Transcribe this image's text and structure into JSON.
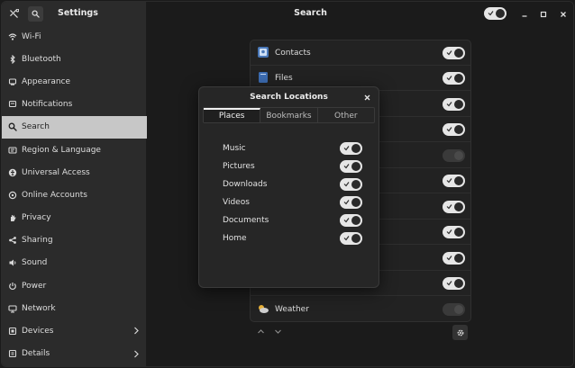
{
  "sidebar": {
    "title": "Settings",
    "items": [
      {
        "label": "Wi-Fi",
        "icon": "wifi-icon"
      },
      {
        "label": "Bluetooth",
        "icon": "bluetooth-icon"
      },
      {
        "label": "Appearance",
        "icon": "appearance-icon"
      },
      {
        "label": "Notifications",
        "icon": "bell-icon"
      },
      {
        "label": "Search",
        "icon": "search-icon",
        "active": true
      },
      {
        "label": "Region & Language",
        "icon": "flag-icon"
      },
      {
        "label": "Universal Access",
        "icon": "accessibility-icon"
      },
      {
        "label": "Online Accounts",
        "icon": "cloud-icon"
      },
      {
        "label": "Privacy",
        "icon": "hand-icon"
      },
      {
        "label": "Sharing",
        "icon": "share-icon"
      },
      {
        "label": "Sound",
        "icon": "speaker-icon"
      },
      {
        "label": "Power",
        "icon": "power-icon"
      },
      {
        "label": "Network",
        "icon": "network-icon"
      },
      {
        "label": "Devices",
        "icon": "devices-icon",
        "chevron": true
      },
      {
        "label": "Details",
        "icon": "info-icon",
        "chevron": true
      }
    ]
  },
  "header": {
    "title": "Search",
    "search_enabled": true
  },
  "search_providers": [
    {
      "label": "Contacts",
      "enabled": true
    },
    {
      "label": "Files",
      "enabled": true
    },
    {
      "label": "",
      "enabled": true
    },
    {
      "label": "",
      "enabled": true
    },
    {
      "label": "",
      "enabled": false
    },
    {
      "label": "",
      "enabled": true
    },
    {
      "label": "",
      "enabled": true
    },
    {
      "label": "",
      "enabled": true
    },
    {
      "label": "",
      "enabled": true
    },
    {
      "label": "",
      "enabled": true
    },
    {
      "label": "Weather",
      "enabled": false
    }
  ],
  "dialog": {
    "title": "Search Locations",
    "tabs": [
      "Places",
      "Bookmarks",
      "Other"
    ],
    "active_tab": "Places",
    "locations": [
      {
        "label": "Music",
        "enabled": true
      },
      {
        "label": "Pictures",
        "enabled": true
      },
      {
        "label": "Downloads",
        "enabled": true
      },
      {
        "label": "Videos",
        "enabled": true
      },
      {
        "label": "Documents",
        "enabled": true
      },
      {
        "label": "Home",
        "enabled": true
      }
    ]
  },
  "colors": {
    "sidebar_bg": "#2b2b2b",
    "active_item_bg": "#c7c7c7",
    "main_bg": "#1b1b1b",
    "switch_on": "#e6e6e6",
    "switch_off": "#3a3a3a"
  }
}
